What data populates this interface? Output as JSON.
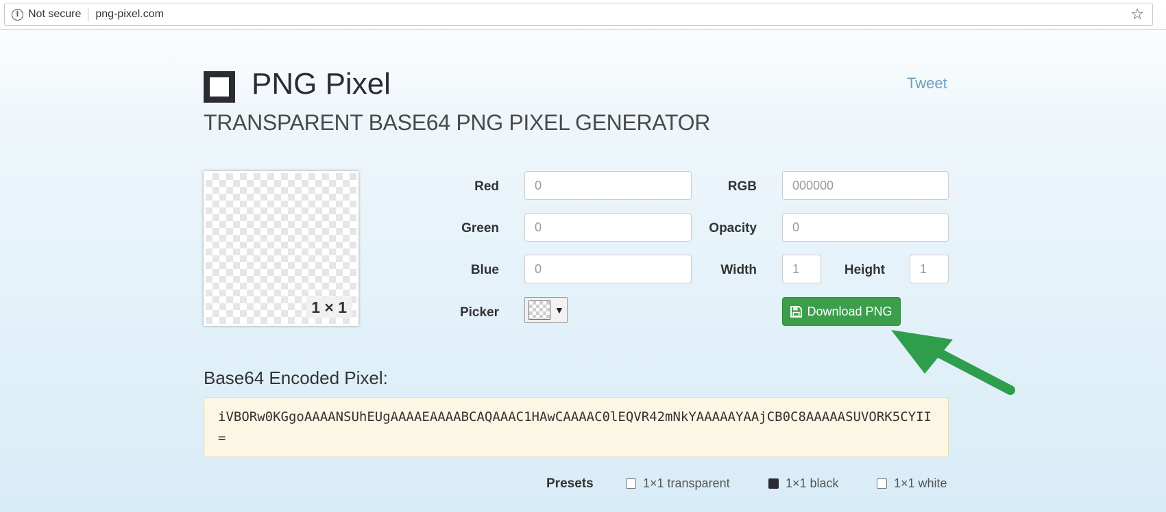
{
  "browser": {
    "security_label": "Not secure",
    "url": "png-pixel.com"
  },
  "header": {
    "title": "PNG Pixel",
    "subtitle": "TRANSPARENT BASE64 PNG PIXEL GENERATOR",
    "tweet_label": "Tweet"
  },
  "preview": {
    "size_label": "1 × 1"
  },
  "form": {
    "red": {
      "label": "Red",
      "value": "0"
    },
    "green": {
      "label": "Green",
      "value": "0"
    },
    "blue": {
      "label": "Blue",
      "value": "0"
    },
    "picker": {
      "label": "Picker"
    },
    "rgb": {
      "label": "RGB",
      "value": "000000"
    },
    "opacity": {
      "label": "Opacity",
      "value": "0"
    },
    "width": {
      "label": "Width",
      "value": "1"
    },
    "height": {
      "label": "Height",
      "value": "1"
    },
    "download_label": "Download PNG"
  },
  "base64": {
    "title": "Base64 Encoded Pixel:",
    "value": "iVBORw0KGgoAAAANSUhEUgAAAAEAAAABCAQAAAC1HAwCAAAAC0lEQVR42mNkYAAAAAYAAjCB0C8AAAAASUVORK5CYII="
  },
  "presets": {
    "label": "Presets",
    "items": [
      {
        "label": "1×1 transparent",
        "checked": false
      },
      {
        "label": "1×1 black",
        "checked": true
      },
      {
        "label": "1×1 white",
        "checked": false
      }
    ]
  },
  "colors": {
    "download_button": "#3a9e4b",
    "arrow": "#2f9e4c",
    "tweet_link": "#6f9fbf",
    "base64_background": "#fcf6e4"
  }
}
